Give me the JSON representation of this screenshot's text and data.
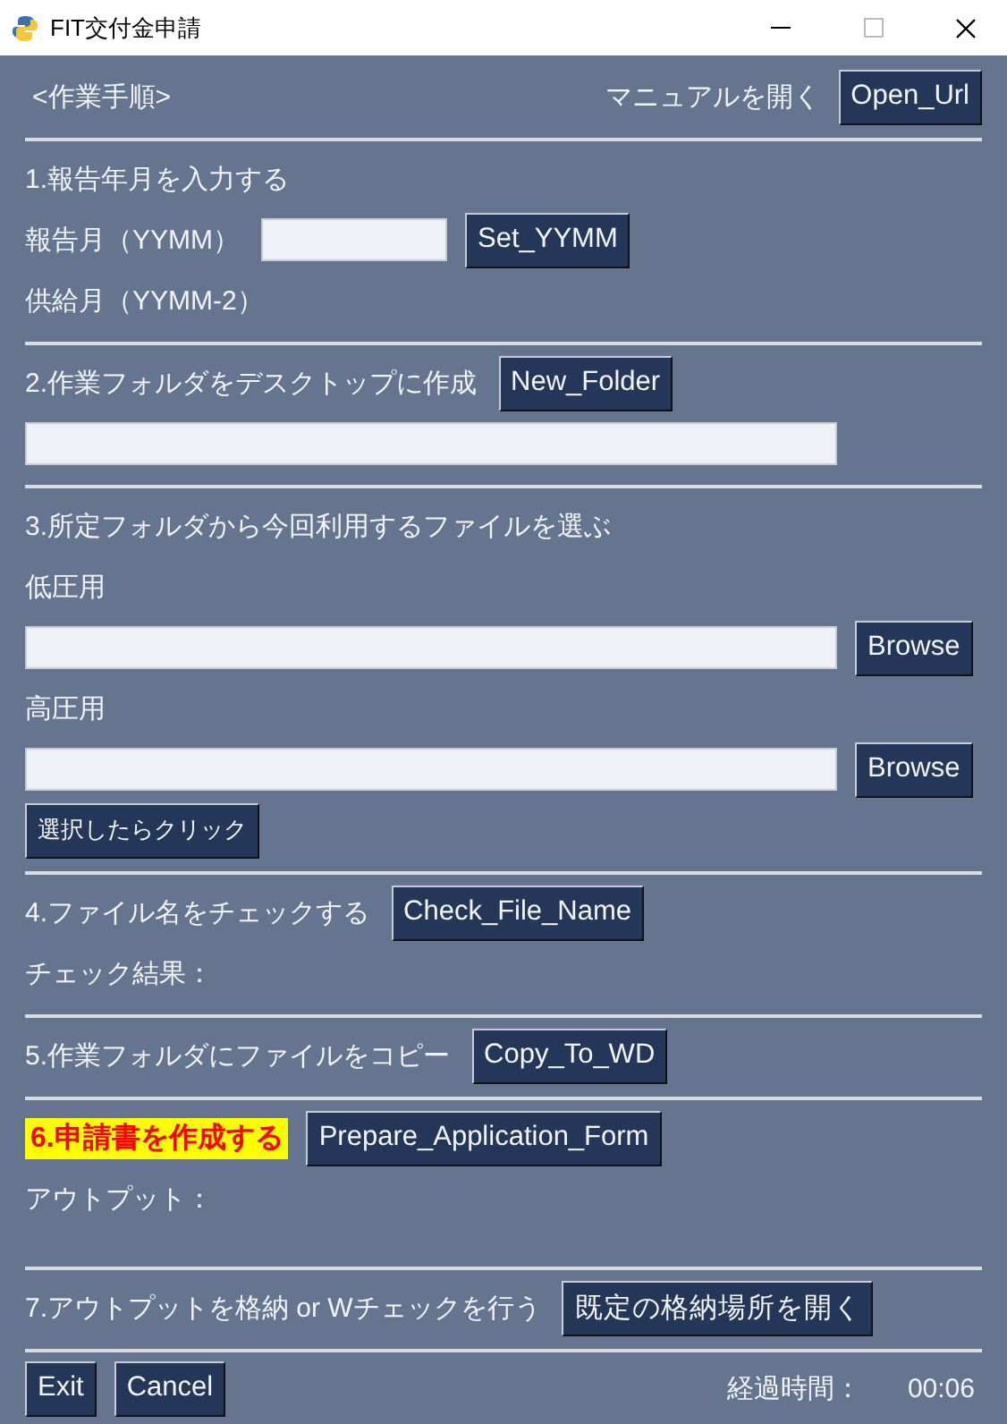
{
  "window": {
    "title": "FIT交付金申請"
  },
  "header": {
    "title": "<作業手順>",
    "manual_label": "マニュアルを開く",
    "button": "Open_Url"
  },
  "sections": [
    {
      "rows": [
        [
          {
            "kind": "text",
            "text": "1.報告年月を入力する"
          }
        ],
        [
          {
            "kind": "text",
            "text": "報告月（YYMM）"
          },
          {
            "kind": "short-field"
          },
          {
            "kind": "button",
            "text": "Set_YYMM"
          }
        ],
        [
          {
            "kind": "text",
            "text": "供給月（YYMM-2）"
          }
        ]
      ]
    },
    {
      "rows": [
        [
          {
            "kind": "text",
            "text": "2.作業フォルダをデスクトップに作成"
          },
          {
            "kind": "button",
            "text": "New_Folder"
          }
        ],
        [
          {
            "kind": "long-field"
          }
        ]
      ]
    },
    {
      "rows": [
        [
          {
            "kind": "text",
            "text": "3.所定フォルダから今回利用するファイルを選ぶ"
          }
        ],
        [
          {
            "kind": "text",
            "text": "低圧用"
          }
        ],
        [
          {
            "kind": "long-field"
          },
          {
            "kind": "button",
            "text": "Browse"
          }
        ],
        [
          {
            "kind": "text",
            "text": "高圧用"
          }
        ],
        [
          {
            "kind": "long-field"
          },
          {
            "kind": "button",
            "text": "Browse"
          }
        ],
        [
          {
            "kind": "small-button",
            "text": "選択したらクリック"
          }
        ]
      ]
    },
    {
      "rows": [
        [
          {
            "kind": "text",
            "text": "4.ファイル名をチェックする"
          },
          {
            "kind": "button",
            "text": "Check_File_Name"
          }
        ],
        [
          {
            "kind": "text",
            "text": "チェック結果："
          }
        ]
      ]
    },
    {
      "rows": [
        [
          {
            "kind": "text",
            "text": "5.作業フォルダにファイルをコピー"
          },
          {
            "kind": "button",
            "text": "Copy_To_WD"
          }
        ]
      ]
    },
    {
      "rows": [
        [
          {
            "kind": "highlight",
            "text": "6.申請書を作成する"
          },
          {
            "kind": "button",
            "text": "Prepare_Application_Form"
          }
        ],
        [
          {
            "kind": "text",
            "text": "アウトプット："
          }
        ]
      ]
    },
    {
      "rows": [
        [
          {
            "kind": "text",
            "text": "7.アウトプットを格納 or Wチェックを行う"
          },
          {
            "kind": "button",
            "text": "既定の格納場所を開く"
          }
        ]
      ]
    }
  ],
  "footer": {
    "buttons": [
      "Exit",
      "Cancel"
    ],
    "elapsed_label": "経過時間：",
    "elapsed": "00:06"
  }
}
